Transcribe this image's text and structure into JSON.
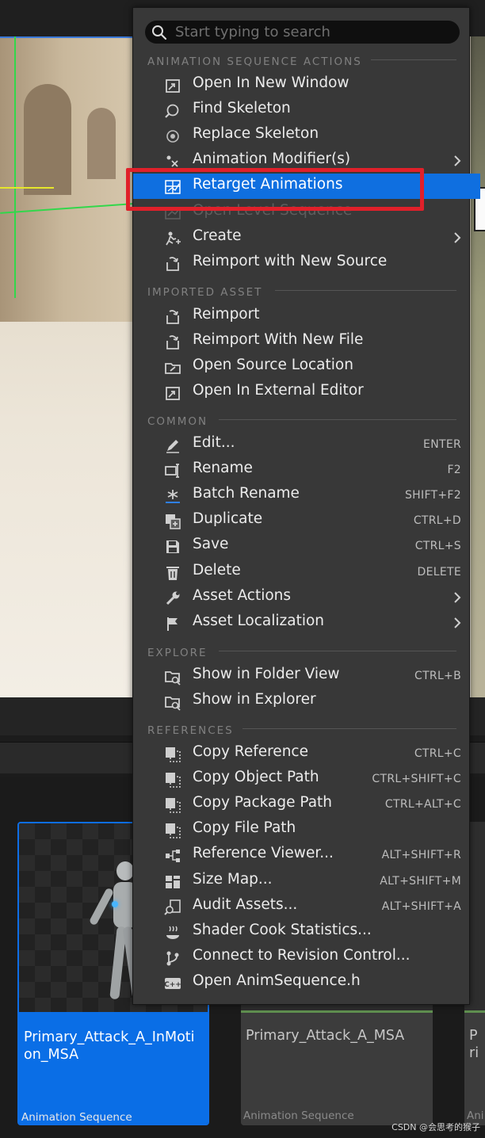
{
  "search": {
    "placeholder": "Start typing to search"
  },
  "sections": {
    "anim": "ANIMATION SEQUENCE ACTIONS",
    "imported": "IMPORTED ASSET",
    "common": "COMMON",
    "explore": "EXPLORE",
    "references": "REFERENCES"
  },
  "menu": {
    "anim_items": [
      {
        "label": "Open In New Window",
        "icon": "open-window-icon"
      },
      {
        "label": "Find Skeleton",
        "icon": "find-skeleton-icon"
      },
      {
        "label": "Replace Skeleton",
        "icon": "replace-skeleton-icon"
      },
      {
        "label": "Animation Modifier(s)",
        "icon": "animation-modifier-icon",
        "submenu": true
      },
      {
        "label": "Retarget Animations",
        "icon": "retarget-icon",
        "highlighted": true
      },
      {
        "label": "Open Level Sequence",
        "icon": "level-sequence-icon",
        "disabled": true
      },
      {
        "label": "Create",
        "icon": "create-icon",
        "submenu": true
      },
      {
        "label": "Reimport with New Source",
        "icon": "reimport-icon"
      }
    ],
    "imported_items": [
      {
        "label": "Reimport",
        "icon": "reimport-icon"
      },
      {
        "label": "Reimport With New File",
        "icon": "reimport-icon"
      },
      {
        "label": "Open Source Location",
        "icon": "folder-open-icon"
      },
      {
        "label": "Open In External Editor",
        "icon": "external-editor-icon"
      }
    ],
    "common_items": [
      {
        "label": "Edit...",
        "shortcut": "ENTER",
        "icon": "edit-icon"
      },
      {
        "label": "Rename",
        "shortcut": "F2",
        "icon": "rename-icon"
      },
      {
        "label": "Batch Rename",
        "shortcut": "SHIFT+F2",
        "icon": "batch-rename-icon"
      },
      {
        "label": "Duplicate",
        "shortcut": "CTRL+D",
        "icon": "duplicate-icon"
      },
      {
        "label": "Save",
        "shortcut": "CTRL+S",
        "icon": "save-icon"
      },
      {
        "label": "Delete",
        "shortcut": "DELETE",
        "icon": "delete-icon"
      },
      {
        "label": "Asset Actions",
        "icon": "wrench-icon",
        "submenu": true
      },
      {
        "label": "Asset Localization",
        "icon": "flag-icon",
        "submenu": true
      }
    ],
    "explore_items": [
      {
        "label": "Show in Folder View",
        "shortcut": "CTRL+B",
        "icon": "folder-search-icon"
      },
      {
        "label": "Show in Explorer",
        "icon": "folder-search-icon"
      }
    ],
    "references_items": [
      {
        "label": "Copy Reference",
        "shortcut": "CTRL+C",
        "icon": "copy-icon"
      },
      {
        "label": "Copy Object Path",
        "shortcut": "CTRL+SHIFT+C",
        "icon": "copy-icon"
      },
      {
        "label": "Copy Package Path",
        "shortcut": "CTRL+ALT+C",
        "icon": "copy-icon"
      },
      {
        "label": "Copy File Path",
        "icon": "copy-icon"
      },
      {
        "label": "Reference Viewer...",
        "shortcut": "ALT+SHIFT+R",
        "icon": "reference-viewer-icon"
      },
      {
        "label": "Size Map...",
        "shortcut": "ALT+SHIFT+M",
        "icon": "size-map-icon"
      },
      {
        "label": "Audit Assets...",
        "shortcut": "ALT+SHIFT+A",
        "icon": "audit-icon"
      },
      {
        "label": "Shader Cook Statistics...",
        "icon": "shader-stats-icon"
      },
      {
        "label": "Connect to Revision Control...",
        "icon": "revision-control-icon"
      },
      {
        "label": "Open AnimSequence.h",
        "icon": "cpp-file-icon"
      }
    ]
  },
  "assets": [
    {
      "name": "Primary_Attack_A_InMotion_MSA",
      "type": "Animation Sequence",
      "selected": true
    },
    {
      "name": "Primary_Attack_A_MSA",
      "type": "Animation Sequence"
    },
    {
      "name": "Pri",
      "type": "Ani"
    }
  ],
  "watermark": "CSDN @会思考的猴子",
  "colors": {
    "menu_bg": "#383838",
    "highlight": "#0f6fe0",
    "annotation_red": "#e0202a",
    "selected_card": "#0a6ee6"
  }
}
